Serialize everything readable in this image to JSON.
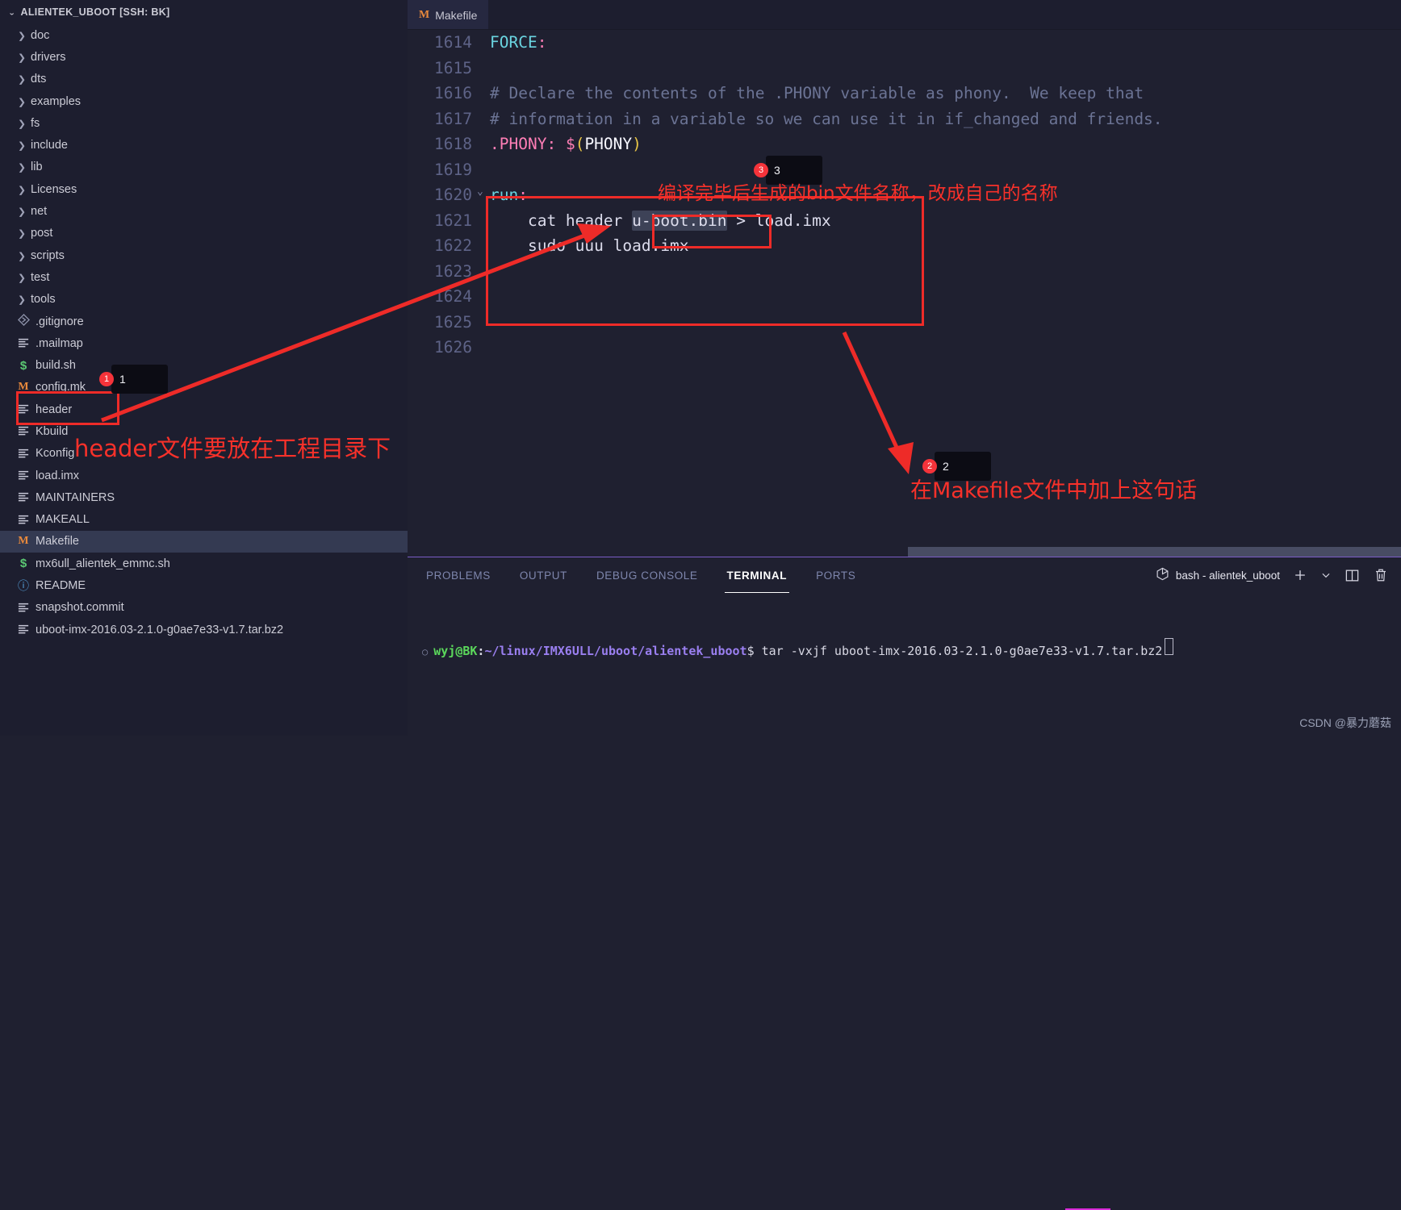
{
  "sidebar": {
    "title": "ALIENTEK_UBOOT [SSH: BK]",
    "collapse_icon": "chevron-down-icon",
    "items": [
      {
        "label": "doc",
        "type": "folder"
      },
      {
        "label": "drivers",
        "type": "folder"
      },
      {
        "label": "dts",
        "type": "folder"
      },
      {
        "label": "examples",
        "type": "folder"
      },
      {
        "label": "fs",
        "type": "folder"
      },
      {
        "label": "include",
        "type": "folder"
      },
      {
        "label": "lib",
        "type": "folder"
      },
      {
        "label": "Licenses",
        "type": "folder"
      },
      {
        "label": "net",
        "type": "folder"
      },
      {
        "label": "post",
        "type": "folder"
      },
      {
        "label": "scripts",
        "type": "folder"
      },
      {
        "label": "test",
        "type": "folder"
      },
      {
        "label": "tools",
        "type": "folder"
      },
      {
        "label": ".gitignore",
        "type": "git"
      },
      {
        "label": ".mailmap",
        "type": "file"
      },
      {
        "label": "build.sh",
        "type": "shell"
      },
      {
        "label": "config.mk",
        "type": "make"
      },
      {
        "label": "header",
        "type": "file"
      },
      {
        "label": "Kbuild",
        "type": "file"
      },
      {
        "label": "Kconfig",
        "type": "file"
      },
      {
        "label": "load.imx",
        "type": "file"
      },
      {
        "label": "MAINTAINERS",
        "type": "file"
      },
      {
        "label": "MAKEALL",
        "type": "file"
      },
      {
        "label": "Makefile",
        "type": "make",
        "selected": true
      },
      {
        "label": "mx6ull_alientek_emmc.sh",
        "type": "shell"
      },
      {
        "label": "README",
        "type": "info"
      },
      {
        "label": "snapshot.commit",
        "type": "file"
      },
      {
        "label": "uboot-imx-2016.03-2.1.0-g0ae7e33-v1.7.tar.bz2",
        "type": "file"
      }
    ]
  },
  "editor": {
    "tab": {
      "label": "Makefile",
      "icon": "makefile-icon"
    },
    "lines": [
      {
        "no": "1614",
        "tokens": [
          {
            "t": "FORCE",
            "c": "c-key"
          },
          {
            "t": ":",
            "c": "c-punc"
          }
        ]
      },
      {
        "no": "1615",
        "tokens": []
      },
      {
        "no": "1616",
        "tokens": [
          {
            "t": "# Declare the contents of the .PHONY variable as phony.  We keep that",
            "c": "c-comment"
          }
        ]
      },
      {
        "no": "1617",
        "tokens": [
          {
            "t": "# information in a variable so we can use it in if_changed and friends.",
            "c": "c-comment"
          }
        ]
      },
      {
        "no": "1618",
        "tokens": [
          {
            "t": ".PHONY",
            "c": "c-punc"
          },
          {
            "t": ": ",
            "c": "c-punc"
          },
          {
            "t": "$",
            "c": "c-dollar"
          },
          {
            "t": "(",
            "c": "c-paren"
          },
          {
            "t": "PHONY",
            "c": "c-var"
          },
          {
            "t": ")",
            "c": "c-paren"
          }
        ]
      },
      {
        "no": "1619",
        "tokens": []
      },
      {
        "no": "1620",
        "fold": true,
        "tokens": [
          {
            "t": "run",
            "c": "c-key"
          },
          {
            "t": ":",
            "c": "c-punc"
          }
        ]
      },
      {
        "no": "1621",
        "tokens": [
          {
            "t": "    cat header ",
            "c": "c-plain"
          },
          {
            "t": "u-boot.bin",
            "c": "c-plain",
            "hl": true
          },
          {
            "t": " > load.imx",
            "c": "c-plain"
          }
        ]
      },
      {
        "no": "1622",
        "tokens": [
          {
            "t": "    sudo uuu load.imx",
            "c": "c-plain"
          }
        ]
      },
      {
        "no": "1623",
        "tokens": []
      },
      {
        "no": "1624",
        "tokens": []
      },
      {
        "no": "1625",
        "tokens": []
      },
      {
        "no": "1626",
        "tokens": []
      }
    ]
  },
  "panel": {
    "tabs": [
      {
        "label": "PROBLEMS",
        "active": false
      },
      {
        "label": "OUTPUT",
        "active": false
      },
      {
        "label": "DEBUG CONSOLE",
        "active": false
      },
      {
        "label": "TERMINAL",
        "active": true
      },
      {
        "label": "PORTS",
        "active": false
      }
    ],
    "terminal_name": "bash - alientek_uboot",
    "actions": [
      {
        "name": "new-terminal-icon",
        "glyph": "+"
      },
      {
        "name": "chevron-down-icon",
        "glyph": "⌄"
      },
      {
        "name": "split-terminal-icon",
        "glyph": "▥"
      },
      {
        "name": "kill-terminal-icon",
        "glyph": "🗑"
      }
    ],
    "terminal": {
      "user": "wyj@BK",
      "colon": ":",
      "path": "~/linux/IMX6ULL/uboot/alientek_uboot",
      "dollar": "$",
      "command": " tar -vxjf uboot-imx-2016.03-2.1.0-g0ae7e33-v1.7.tar.bz2"
    }
  },
  "annotations": {
    "callout1": {
      "number": "1",
      "bubble": "1"
    },
    "callout2": {
      "number": "2",
      "bubble": "2"
    },
    "callout3": {
      "number": "3",
      "bubble": "3"
    },
    "note_header": "header文件要放在工程目录下",
    "note_bin": "编译完毕后生成的bin文件名称，改成自己的名称",
    "note_makefile": "在Makefile文件中加上这句话",
    "accent_red": "#f8312a"
  },
  "watermark": "CSDN @暴力蘑菇"
}
